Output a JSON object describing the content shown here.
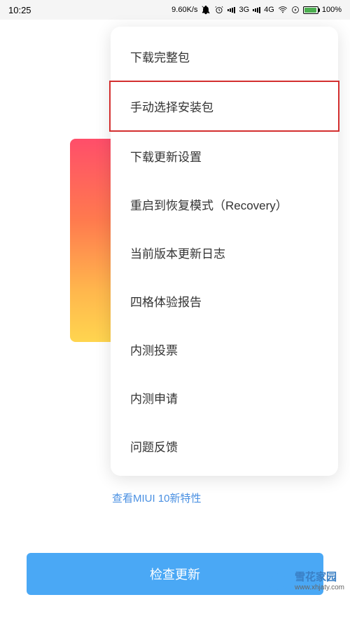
{
  "status_bar": {
    "time": "10:25",
    "speed": "9.60K/s",
    "net1": "3G",
    "net2": "4G",
    "battery_pct": "100%"
  },
  "menu": {
    "items": [
      "下载完整包",
      "手动选择安装包",
      "下载更新设置",
      "重启到恢复模式（Recovery）",
      "当前版本更新日志",
      "四格体验报告",
      "内测投票",
      "内测申请",
      "问题反馈"
    ]
  },
  "bottom_link": "查看MIUI 10新特性",
  "check_button": "检查更新",
  "watermark": {
    "title": "雪花家园",
    "url": "www.xhjaty.com"
  }
}
